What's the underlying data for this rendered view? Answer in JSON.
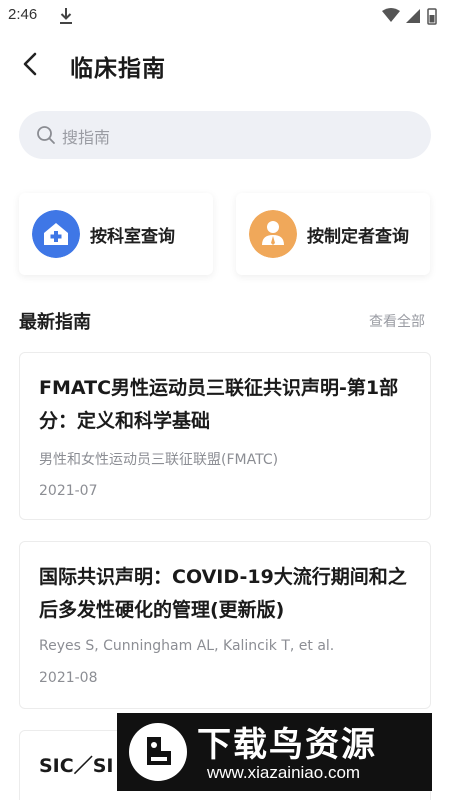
{
  "status_bar": {
    "time": "2:46"
  },
  "header": {
    "title": "临床指南"
  },
  "search": {
    "placeholder": "搜指南"
  },
  "quick_query": [
    {
      "label": "按科室查询",
      "icon": "hospital-icon",
      "color": "#3f77e6"
    },
    {
      "label": "按制定者查询",
      "icon": "person-icon",
      "color": "#f0a85a"
    }
  ],
  "latest": {
    "title": "最新指南",
    "view_all": "查看全部"
  },
  "guides": [
    {
      "title": "FMATC男性运动员三联征共识声明-第1部分：定义和科学基础",
      "author": "男性和女性运动员三联征联盟(FMATC)",
      "date": "2021-07"
    },
    {
      "title": "国际共识声明：COVID-19大流行期间和之后多发性硬化的管理(更新版)",
      "author": "Reyes S, Cunningham AL, Kalincik T, et al.",
      "date": "2021-08"
    },
    {
      "title": "SIC／SI",
      "author": "",
      "date": ""
    }
  ],
  "watermark": {
    "main": "下载鸟资源",
    "url": "www.xiazainiao.com"
  },
  "colors": {
    "accent_blue": "#3f77e6",
    "accent_orange": "#f0a85a",
    "search_bg": "#eef0f5"
  }
}
